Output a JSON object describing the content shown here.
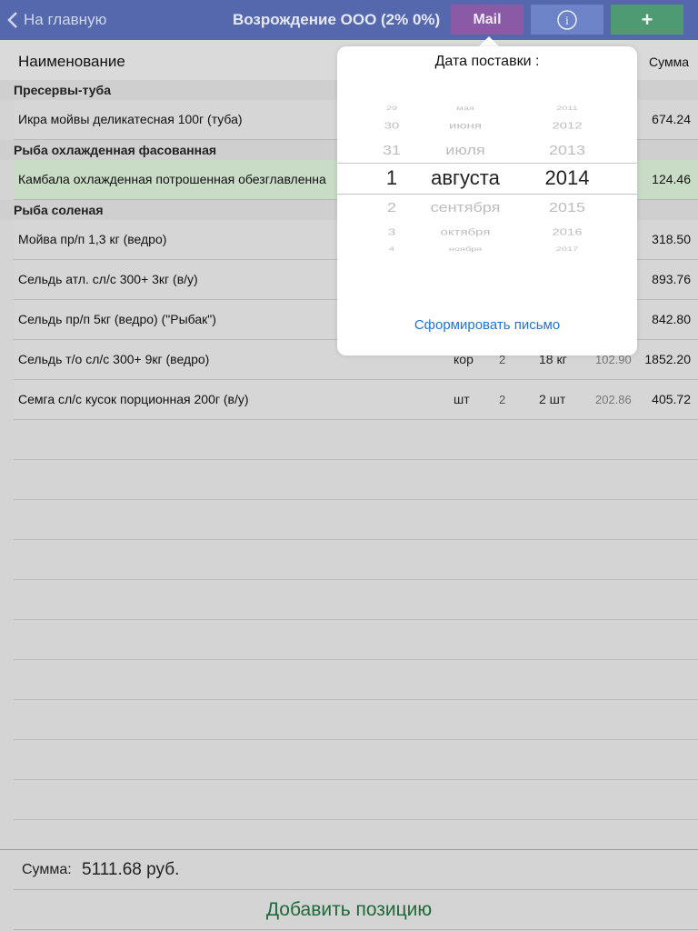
{
  "nav": {
    "back_label": "На главную",
    "title": "Возрождение ООО (2% 0%)",
    "mail_label": "Mail",
    "add_label": "+",
    "info_glyph": "i",
    "colors": {
      "bar": "#5568ad",
      "mail": "#8a5aa6",
      "info": "#6c84c7",
      "add": "#4e9a73"
    }
  },
  "columns": {
    "name": "Наименование",
    "sum": "Сумма"
  },
  "sections": [
    {
      "title": "Пресервы-туба",
      "rows": [
        {
          "name": "Икра мойвы деликатесная 100г (туба)",
          "unit": "",
          "qty": "",
          "amount": "",
          "price": "",
          "sum": "674.24",
          "highlight": false
        }
      ]
    },
    {
      "title": "Рыба охлажденная фасованная",
      "rows": [
        {
          "name": "Камбала охлажденная потрошенная обезглавленна",
          "unit": "",
          "qty": "",
          "amount": "",
          "price": "",
          "sum": "124.46",
          "highlight": true
        }
      ]
    },
    {
      "title": "Рыба соленая",
      "rows": [
        {
          "name": "Мойва пр/п 1,3 кг (ведро)",
          "unit": "",
          "qty": "",
          "amount": "",
          "price": "",
          "sum": "318.50",
          "highlight": false
        },
        {
          "name": "Сельдь атл. сл/с 300+ 3кг (в/у)",
          "unit": "",
          "qty": "",
          "amount": "",
          "price": "",
          "sum": "893.76",
          "highlight": false
        },
        {
          "name": "Сельдь пр/п 5кг (ведро) (\"Рыбак\")",
          "unit": "",
          "qty": "",
          "amount": "",
          "price": "",
          "sum": "842.80",
          "highlight": false
        },
        {
          "name": "Сельдь т/о сл/с 300+ 9кг (ведро)",
          "unit": "кор",
          "qty": "2",
          "amount": "18 кг",
          "price": "102.90",
          "sum": "1852.20",
          "highlight": false
        },
        {
          "name": "Семга сл/с кусок порционная 200г (в/у)",
          "unit": "шт",
          "qty": "2",
          "amount": "2 шт",
          "price": "202.86",
          "sum": "405.72",
          "highlight": false
        }
      ]
    }
  ],
  "popover": {
    "title": "Дата поставки :",
    "picker": {
      "days": [
        "29",
        "30",
        "31",
        "1",
        "2",
        "3",
        "4"
      ],
      "months": [
        "мая",
        "июня",
        "июля",
        "августа",
        "сентября",
        "октября",
        "ноября"
      ],
      "years": [
        "2011",
        "2012",
        "2013",
        "2014",
        "2015",
        "2016",
        "2017"
      ],
      "selected_index": 3
    },
    "action_label": "Сформировать письмо"
  },
  "footer": {
    "sum_label": "Сумма:",
    "sum_value": "5111.68 руб.",
    "add_label": "Добавить позицию"
  }
}
